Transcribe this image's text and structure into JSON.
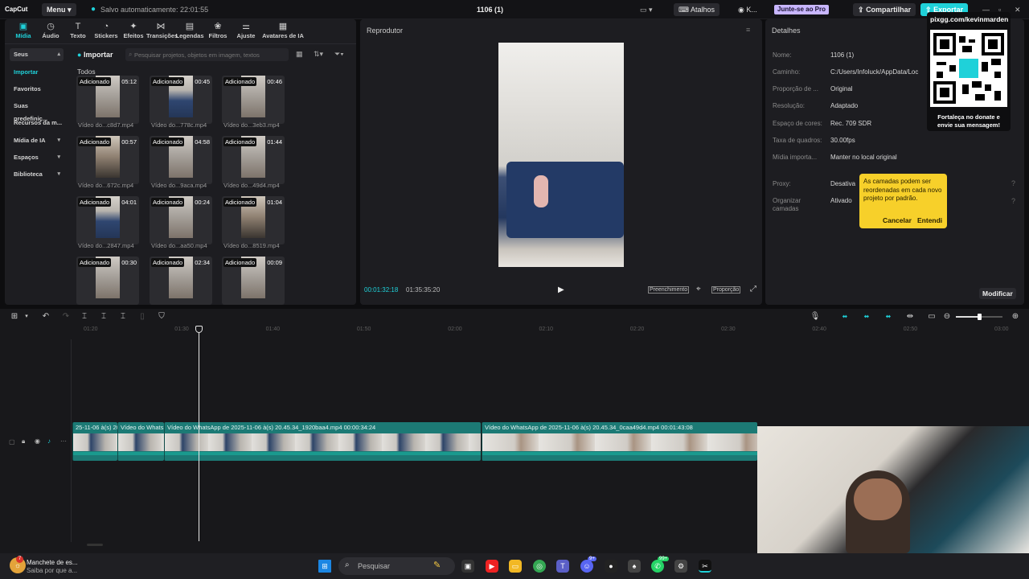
{
  "topbar": {
    "app_name": "CapCut",
    "menu_label": "Menu",
    "save_status": "Salvo automaticamente: 22:01:55",
    "project_title": "1106 (1)",
    "shortcuts_label": "Atalhos",
    "user_label": "K...",
    "pro_label": "Junte-se ao Pro",
    "share_label": "Compartilhar",
    "export_label": "Exportar"
  },
  "toolbar": {
    "tools": [
      {
        "label": "Mídia",
        "icon": "media-icon"
      },
      {
        "label": "Áudio",
        "icon": "audio-icon"
      },
      {
        "label": "Texto",
        "icon": "text-icon"
      },
      {
        "label": "Stickers",
        "icon": "sticker-icon"
      },
      {
        "label": "Efeitos",
        "icon": "effects-icon"
      },
      {
        "label": "Transições",
        "icon": "transitions-icon"
      },
      {
        "label": "Legendas",
        "icon": "captions-icon"
      },
      {
        "label": "Filtros",
        "icon": "filters-icon"
      },
      {
        "label": "Ajuste",
        "icon": "adjust-icon"
      },
      {
        "label": "Avatares de IA",
        "icon": "avatar-icon"
      }
    ]
  },
  "sidebar": {
    "items": [
      {
        "label": "Seus"
      },
      {
        "label": "Importar"
      },
      {
        "label": "Favoritos"
      },
      {
        "label": "Suas predefiniç..."
      },
      {
        "label": "Recursos da m..."
      },
      {
        "label": "Mídia de IA"
      },
      {
        "label": "Espaços"
      },
      {
        "label": "Biblioteca"
      }
    ]
  },
  "media": {
    "import_label": "Importar",
    "search_placeholder": "Pesquisar projetos, objetos em imagem, textos",
    "section_label": "Todos",
    "added_tag": "Adicionado",
    "items": [
      {
        "duration": "05:12",
        "name": "Vídeo do...c8d7.mp4"
      },
      {
        "duration": "00:45",
        "name": "Vídeo do...778c.mp4"
      },
      {
        "duration": "00:46",
        "name": "Vídeo do...3eb3.mp4"
      },
      {
        "duration": "00:57",
        "name": "Vídeo do...672c.mp4"
      },
      {
        "duration": "04:58",
        "name": "Vídeo do...9aca.mp4"
      },
      {
        "duration": "01:44",
        "name": "Vídeo do...49d4.mp4"
      },
      {
        "duration": "04:01",
        "name": "Vídeo do...2847.mp4"
      },
      {
        "duration": "00:24",
        "name": "Vídeo do...aa50.mp4"
      },
      {
        "duration": "01:04",
        "name": "Vídeo do...8519.mp4"
      },
      {
        "duration": "00:30",
        "name": "Vídeo do...c1f0.mp4"
      },
      {
        "duration": "02:34",
        "name": "Vídeo do...bdd4.mp4"
      },
      {
        "duration": "00:09",
        "name": "Vídeo do...04b8.mp4"
      }
    ]
  },
  "player": {
    "title": "Reprodutor",
    "current_time": "00:01:32:18",
    "total_time": "01:35:35:20",
    "fill_label": "Preenchimento",
    "ratio_label": "Proporção"
  },
  "details": {
    "title": "Detalhes",
    "rows": [
      {
        "label": "Nome:",
        "value": "1106 (1)"
      },
      {
        "label": "Caminho:",
        "value": "C:/Users/Infoluck/AppData/Loc"
      },
      {
        "label": "Proporção de ...",
        "value": "Original"
      },
      {
        "label": "Resolução:",
        "value": "Adaptado"
      },
      {
        "label": "Espaço de cores:",
        "value": "Rec. 709 SDR"
      },
      {
        "label": "Taxa de quadros:",
        "value": "30.00fps"
      },
      {
        "label": "Mídia importa...",
        "value": "Manter no local original"
      },
      {
        "label": "Proxy:",
        "value": "Desativa"
      },
      {
        "label": "Organizar camadas",
        "value": "Ativado"
      }
    ],
    "modify_label": "Modificar"
  },
  "tooltip": {
    "text": "As camadas podem ser reordenadas em cada novo projeto por padrão.",
    "cancel_label": "Cancelar",
    "ok_label": "Entendi"
  },
  "promo": {
    "url": "pixgg.com/kevinmarden",
    "caption": "Fortaleça no donate e envie sua mensagem!"
  },
  "timeline": {
    "ticks": [
      "01:20",
      "01:30",
      "01:40",
      "01:50",
      "02:00",
      "02:10",
      "02:20",
      "02:30",
      "02:40",
      "02:50",
      "03:00"
    ],
    "clips": [
      {
        "label": "25-11-06 à(s) 20"
      },
      {
        "label": "Vídeo do Whats"
      },
      {
        "label": "Vídeo do WhatsApp de 2025-11-06 à(s) 20.45.34_1920baa4.mp4  00:00:34:24"
      },
      {
        "label": "Vídeo do WhatsApp de 2025-11-06 à(s) 20.45.34_0caa49d4.mp4  00:01:43:08"
      }
    ]
  },
  "taskbar": {
    "news_title": "Manchete de es...",
    "news_sub": "Saiba por que a...",
    "search_placeholder": "Pesquisar",
    "badge_1": "9+",
    "badge_2": "99+"
  },
  "colors": {
    "accent": "#1fd1d9",
    "clip_teal": "#1c7a75",
    "tooltip": "#f7d02a",
    "pro": "#c8b6ff"
  }
}
